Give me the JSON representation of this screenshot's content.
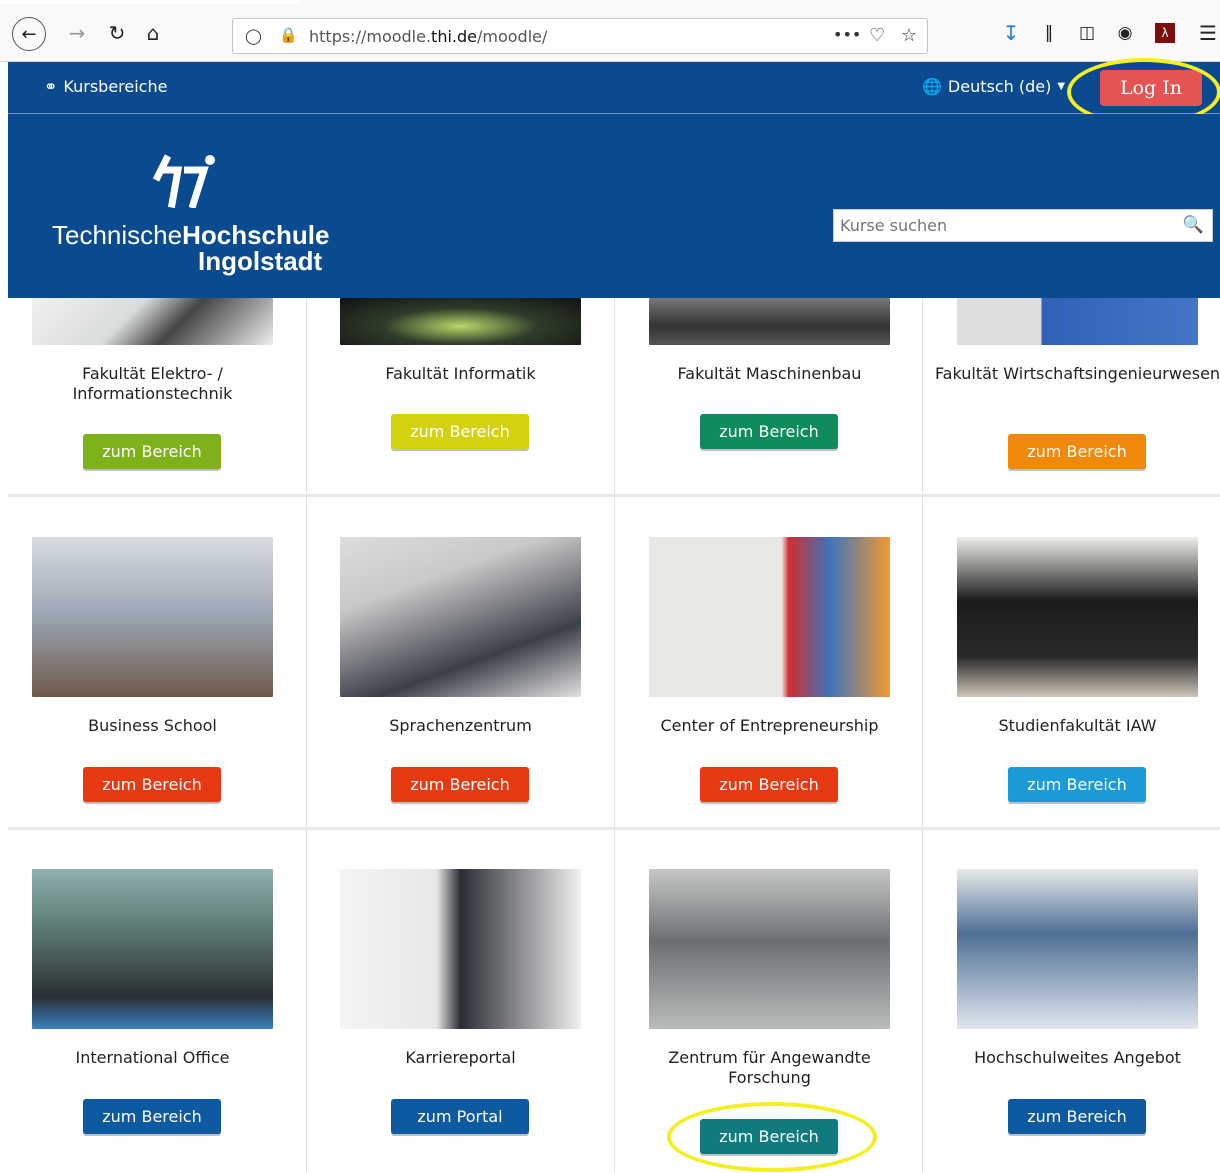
{
  "browser": {
    "url_prefix": "https://moodle.",
    "url_domain": "thi.de",
    "url_suffix": "/moodle/",
    "menu_dots": "•••"
  },
  "navbar": {
    "course_areas": "Kursbereiche",
    "language": "Deutsch (de)",
    "login": "Log In"
  },
  "header": {
    "logo_part1": "Technische",
    "logo_part2": "Hochschule",
    "logo_part3": "Ingolstadt",
    "search_placeholder": "Kurse suchen"
  },
  "cards": [
    {
      "title": "Fakultät Elektro- / Informationstechnik",
      "button": "zum Bereich",
      "button_color": "#7fb11a"
    },
    {
      "title": "Fakultät Informatik",
      "button": "zum Bereich",
      "button_color": "#d4d10f"
    },
    {
      "title": "Fakultät Maschinenbau",
      "button": "zum Bereich",
      "button_color": "#0e8c5b"
    },
    {
      "title": "Fakultät Wirtschaftsingenieurwesen",
      "button": "zum Bereich",
      "button_color": "#f0880a"
    },
    {
      "title": "Business School",
      "button": "zum Bereich",
      "button_color": "#e83a12"
    },
    {
      "title": "Sprachenzentrum",
      "button": "zum Bereich",
      "button_color": "#e83a12"
    },
    {
      "title": "Center of Entrepreneurship",
      "button": "zum Bereich",
      "button_color": "#e83a12"
    },
    {
      "title": "Studienfakultät IAW",
      "button": "zum Bereich",
      "button_color": "#1a9ad6"
    },
    {
      "title": "International Office",
      "button": "zum Bereich",
      "button_color": "#0d5aa0"
    },
    {
      "title": "Karriereportal",
      "button": "zum Portal",
      "button_color": "#0d5aa0"
    },
    {
      "title": "Zentrum für Angewandte Forschung",
      "button": "zum Bereich",
      "button_color": "#0f7b7f"
    },
    {
      "title": "Hochschulweites Angebot",
      "button": "zum Bereich",
      "button_color": "#0d5aa0"
    }
  ],
  "colors": {
    "brand_blue": "#0b4a8f",
    "login_red": "#e55353",
    "highlight_yellow": "#f4ef21"
  }
}
